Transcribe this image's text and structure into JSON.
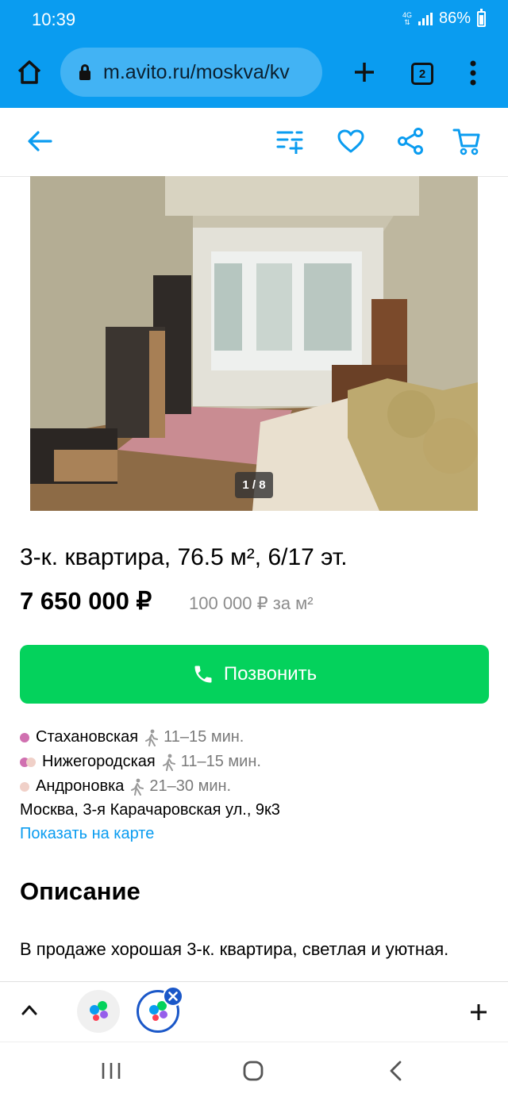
{
  "status": {
    "time": "10:39",
    "network": "4G",
    "battery": "86%"
  },
  "browser": {
    "url": "m.avito.ru/moskva/kv",
    "tab_count": "2"
  },
  "listing": {
    "photo_counter": "1 / 8",
    "title": "3-к. квартира, 76.5 м², 6/17 эт.",
    "price": "7 650 000 ₽",
    "price_per_m2": "100 000 ₽ за м²",
    "call_label": "Позвонить",
    "metro": [
      {
        "name": "Стахановская",
        "time": "11–15 мин.",
        "colors": [
          "#d070b0"
        ]
      },
      {
        "name": "Нижегородская",
        "time": "11–15 мин.",
        "colors": [
          "#d070b0",
          "#f0d0c8"
        ]
      },
      {
        "name": "Андроновка",
        "time": "21–30 мин.",
        "colors": [
          "#f0d0c8"
        ]
      }
    ],
    "address": "Москва, 3-я Карачаровская ул., 9к3",
    "map_link": "Показать на карте",
    "description_heading": "Описание",
    "description_text": "В продаже хорошая 3-к. квартира, светлая и уютная."
  },
  "colors": {
    "accent": "#0a9cf0",
    "call_button": "#04d25c"
  }
}
